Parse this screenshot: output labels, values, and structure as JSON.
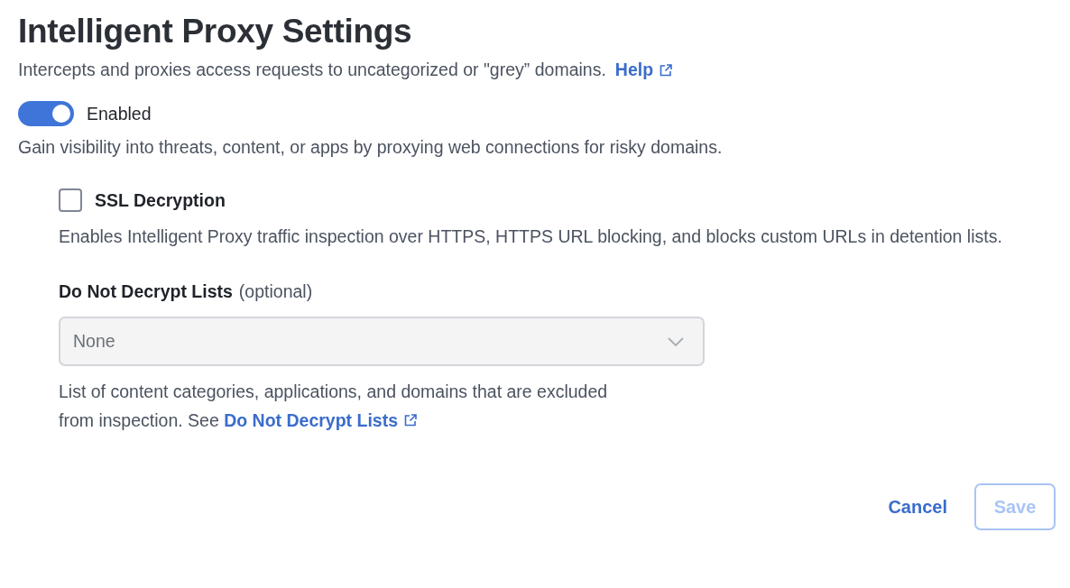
{
  "title": "Intelligent Proxy Settings",
  "description": "Intercepts and proxies access requests to uncategorized or \"grey” domains.",
  "help_link": "Help",
  "toggle": {
    "label": "Enabled",
    "on": true
  },
  "toggle_description": "Gain visibility into threats, content, or apps by proxying web connections for risky domains.",
  "ssl": {
    "label": "SSL Decryption",
    "checked": false,
    "description": "Enables Intelligent Proxy traffic inspection over HTTPS, HTTPS URL blocking, and blocks custom URLs in detention lists."
  },
  "do_not_decrypt": {
    "label": "Do Not Decrypt Lists",
    "optional": "(optional)",
    "value": "None",
    "disabled": true,
    "help": "List of content categories, applications, and domains that are excluded from inspection. See",
    "help_link": "Do Not Decrypt Lists"
  },
  "buttons": [
    {
      "label": "Cancel",
      "kind": "link",
      "disabled": false
    },
    {
      "label": "Save",
      "kind": "outline",
      "disabled": true
    }
  ]
}
